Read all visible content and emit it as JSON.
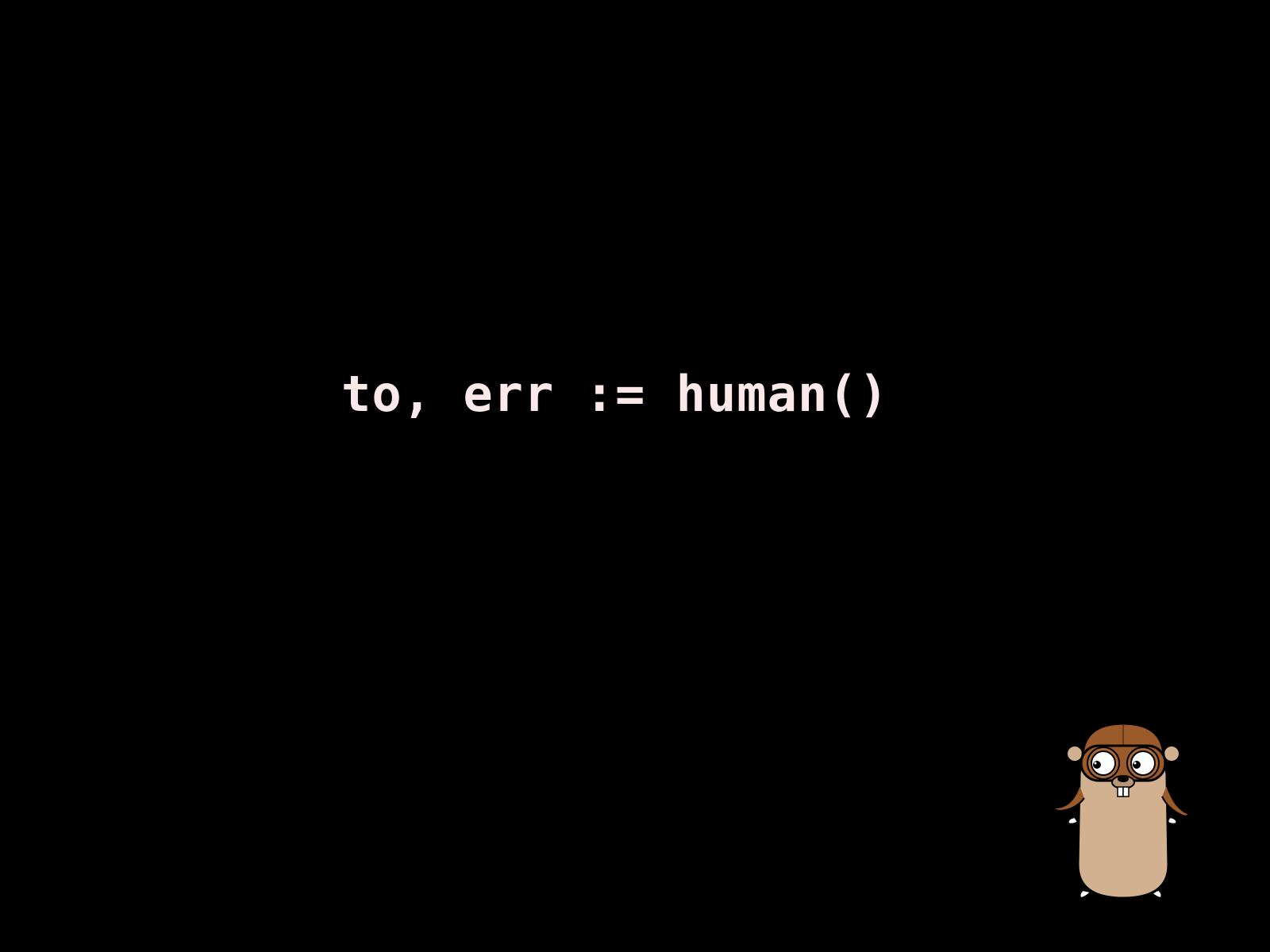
{
  "slide": {
    "code_text": "to, err := human()",
    "background_color": "#000000",
    "text_color": "#fbe9e9"
  },
  "mascot": {
    "icon": "go-gopher-aviator-icon"
  }
}
